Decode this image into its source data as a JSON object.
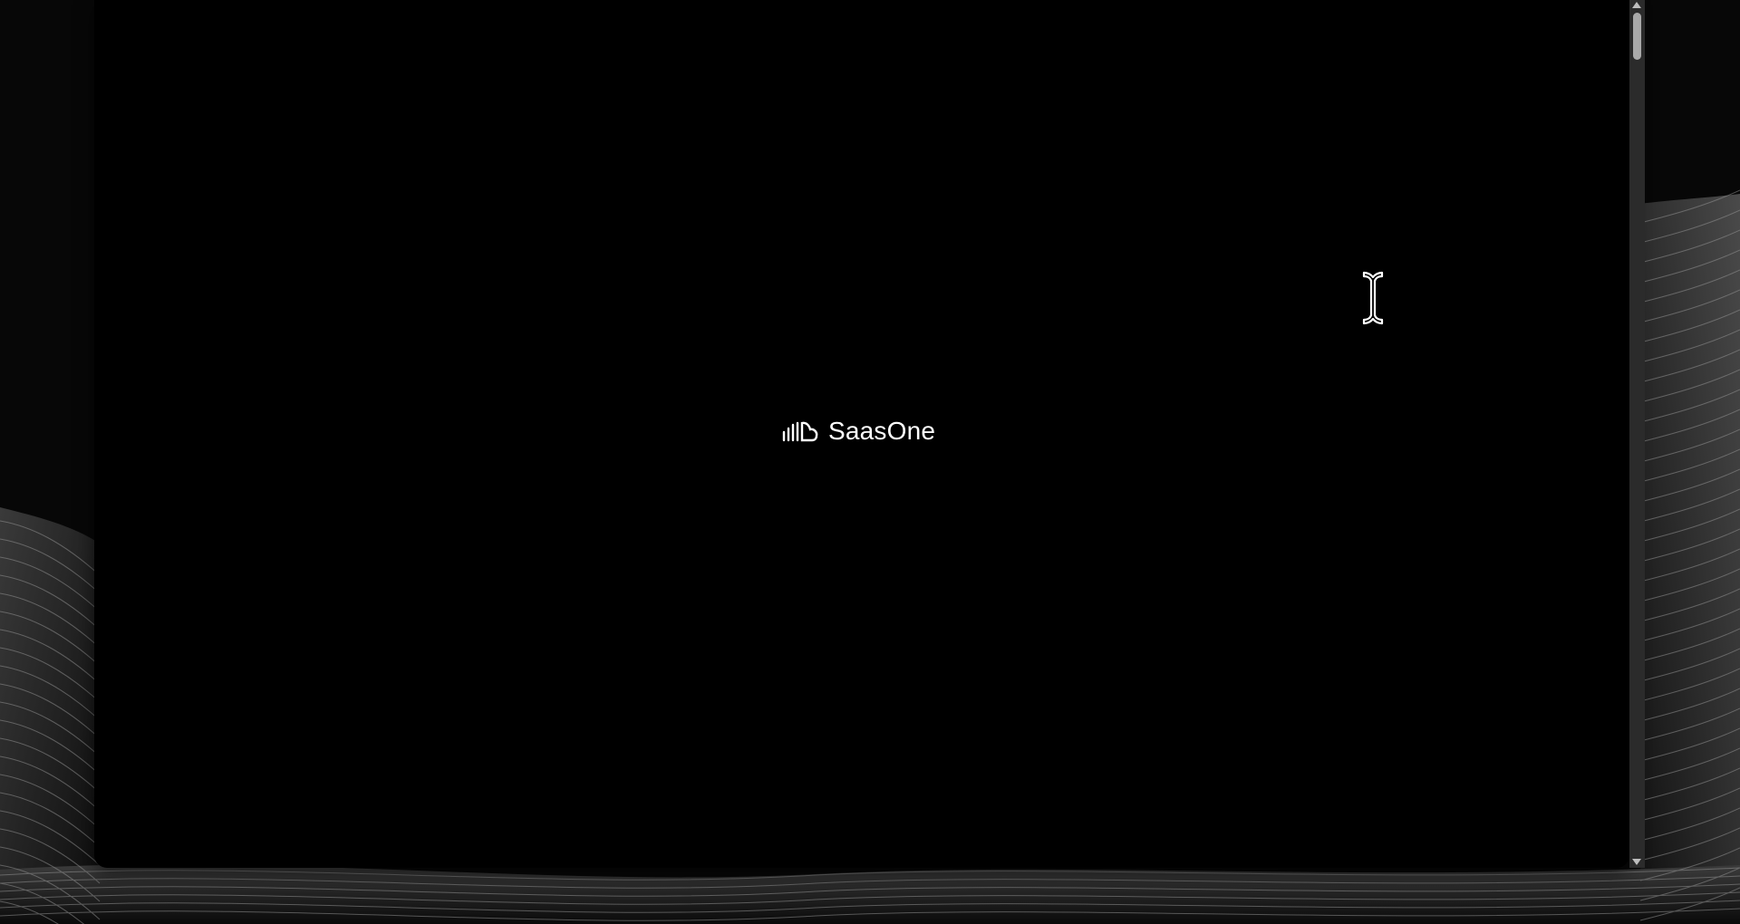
{
  "brand": {
    "name": "SaasOne",
    "icon": "soundwave-cloud-icon",
    "text_color": "#ffffff"
  },
  "window": {
    "background_color": "#000000"
  },
  "wallpaper": {
    "theme": "dark grey flowing wave lines",
    "base_color": "#070707",
    "line_color": "#9a9a9a"
  },
  "pointer": {
    "type": "text-cursor-icon"
  }
}
